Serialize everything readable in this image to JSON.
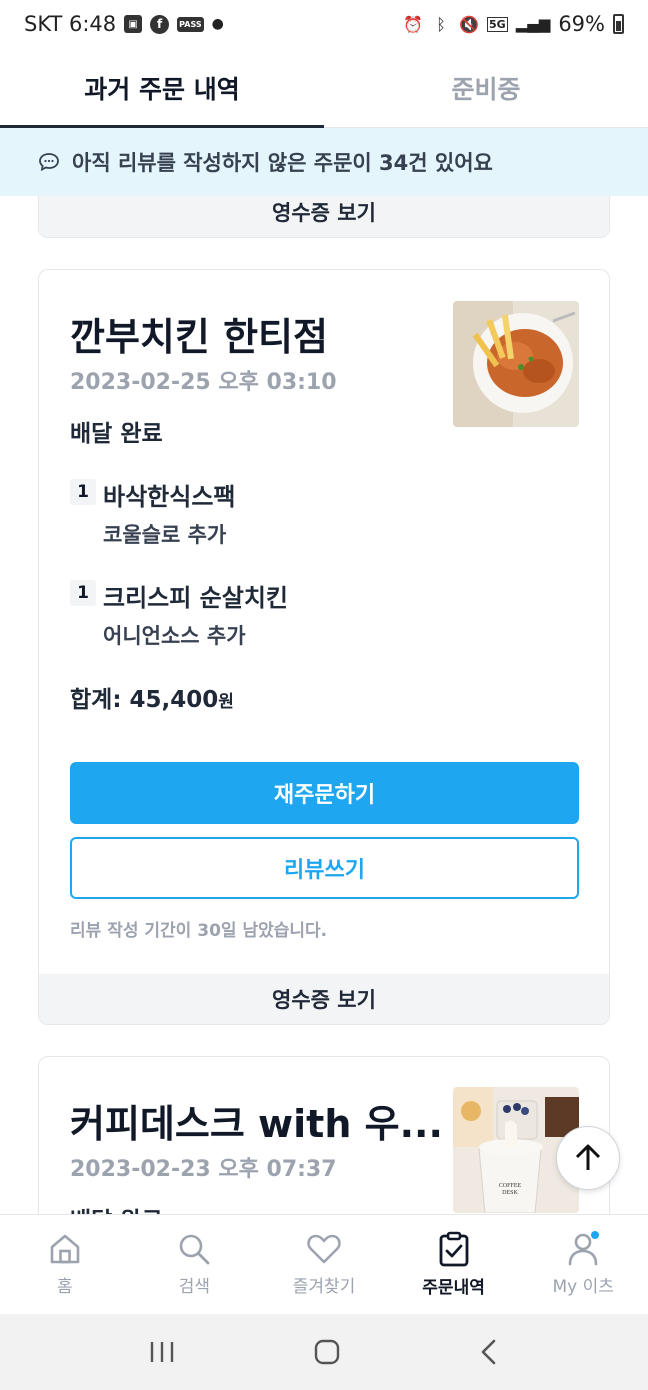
{
  "status_bar": {
    "carrier_time": "SKT 6:48",
    "network": "5G",
    "battery": "69%"
  },
  "tabs": [
    {
      "label": "과거 주문 내역",
      "active": true
    },
    {
      "label": "준비중",
      "active": false
    }
  ],
  "banner": {
    "text": "아직 리뷰를 작성하지 않은 주문이 34건 있어요"
  },
  "partial_card": {
    "receipt_label": "영수증 보기"
  },
  "orders": [
    {
      "store": "깐부치킨 한티점",
      "date": "2023-02-25 오후 03:10",
      "status": "배달 완료",
      "items": [
        {
          "qty": "1",
          "name": "바삭한식스팩",
          "option": "코울슬로 추가"
        },
        {
          "qty": "1",
          "name": "크리스피 순살치킨",
          "option": "어니언소스 추가"
        }
      ],
      "total_label": "합계: ",
      "total_value": "45,400",
      "total_unit": "원",
      "reorder_label": "재주문하기",
      "review_label": "리뷰쓰기",
      "review_note": "리뷰 작성 기간이 30일 남았습니다.",
      "receipt_label": "영수증 보기"
    },
    {
      "store": "커피데스크 with 우...",
      "date": "2023-02-23 오후 07:37",
      "status": "배달 완료"
    }
  ],
  "thumb_text": {
    "coffee_cup": "COFFEE DESK"
  },
  "bottom_nav": [
    {
      "label": "홈",
      "icon": "home-icon"
    },
    {
      "label": "검색",
      "icon": "search-icon"
    },
    {
      "label": "즐겨찾기",
      "icon": "heart-icon"
    },
    {
      "label": "주문내역",
      "icon": "order-list-icon",
      "active": true
    },
    {
      "label": "My 이츠",
      "icon": "person-icon"
    }
  ],
  "colors": {
    "accent": "#1ea7f0",
    "banner_bg": "#e4f5fb"
  }
}
